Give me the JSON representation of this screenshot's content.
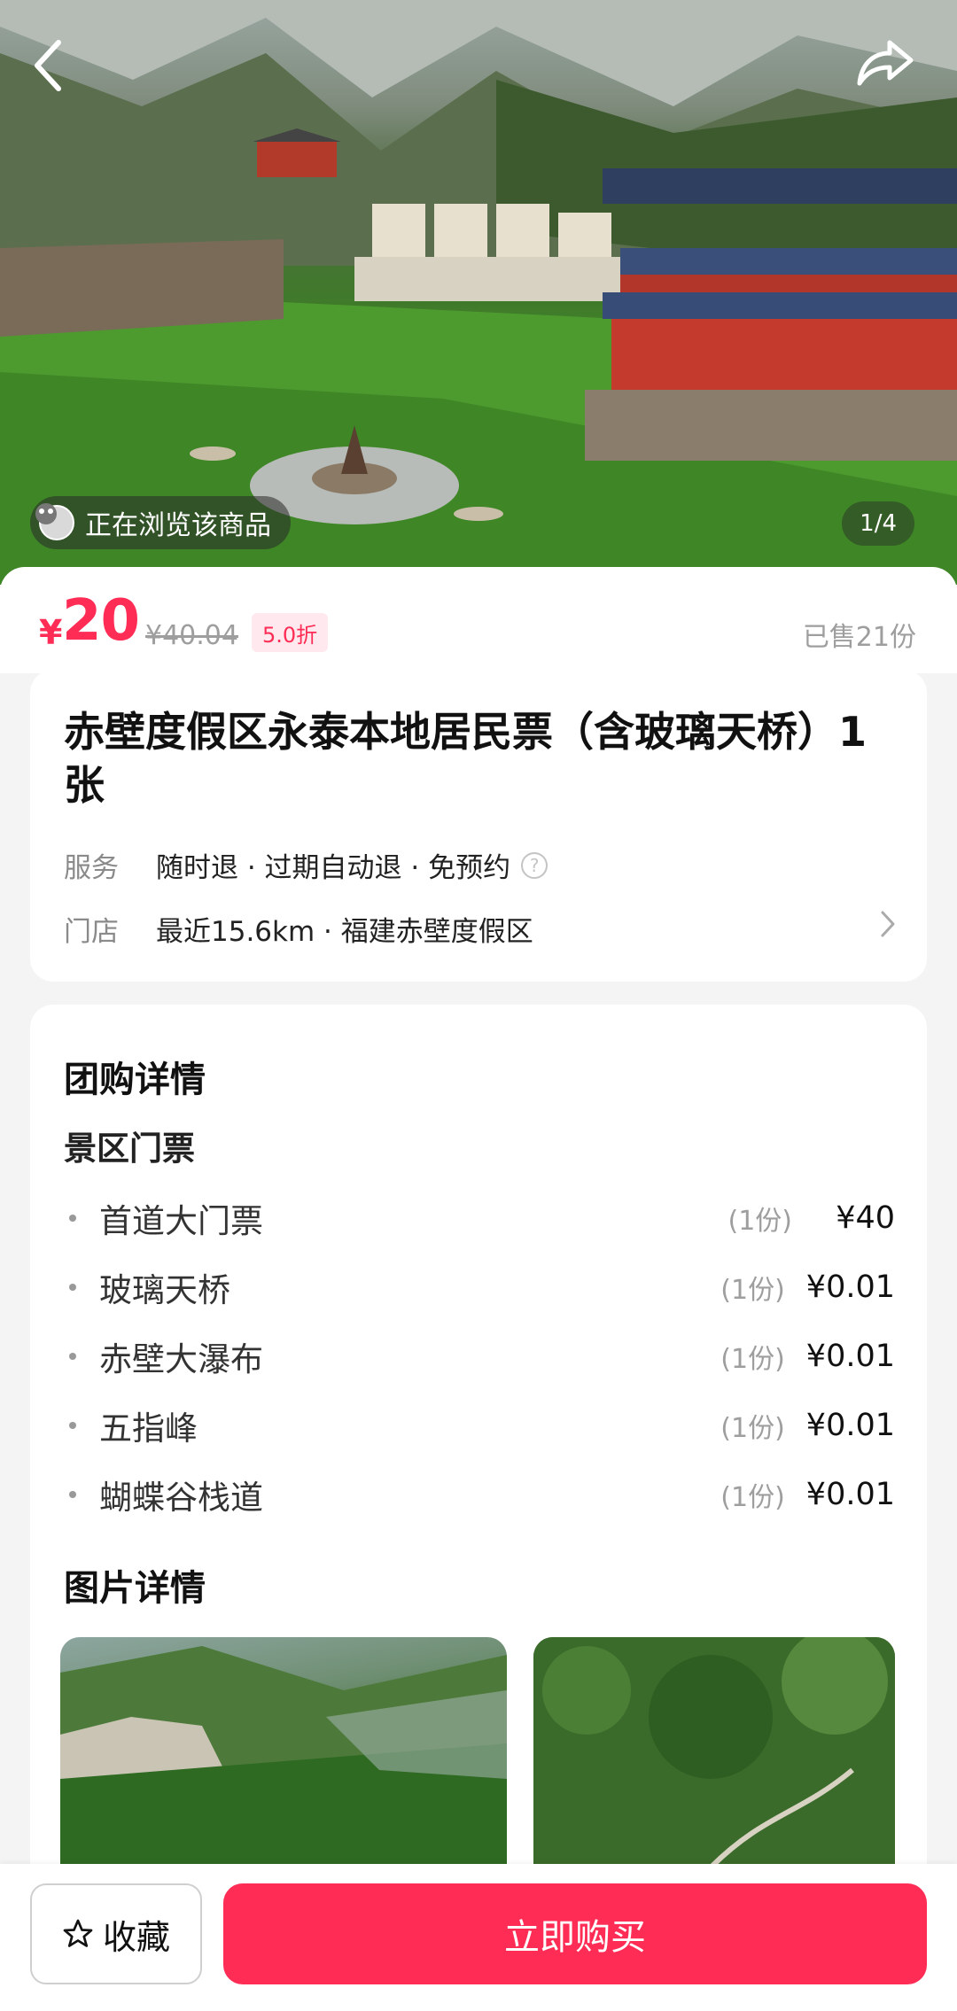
{
  "hero": {
    "browsing_text": "正在浏览该商品",
    "image_counter": "1/4",
    "icons": [
      "back-arrow-icon",
      "share-icon",
      "avatar"
    ]
  },
  "price": {
    "currency": "¥",
    "current": "20",
    "original": "¥40.04",
    "discount": "5.0折",
    "sold": "已售21份"
  },
  "product": {
    "title": "赤壁度假区永泰本地居民票（含玻璃天桥）1张",
    "service_label": "服务",
    "service_value": "随时退 · 过期自动退 · 免预约",
    "store_label": "门店",
    "store_value": "最近15.6km · 福建赤壁度假区"
  },
  "group_details": {
    "heading": "团购详情",
    "subheading": "景区门票",
    "items": [
      {
        "name": "首道大门票",
        "qty": "(1份)",
        "price": "¥40"
      },
      {
        "name": "玻璃天桥",
        "qty": "(1份)",
        "price": "¥0.01"
      },
      {
        "name": "赤壁大瀑布",
        "qty": "(1份)",
        "price": "¥0.01"
      },
      {
        "name": "五指峰",
        "qty": "(1份)",
        "price": "¥0.01"
      },
      {
        "name": "蝴蝶谷栈道",
        "qty": "(1份)",
        "price": "¥0.01"
      }
    ]
  },
  "photo_details": {
    "heading": "图片详情"
  },
  "bottom_bar": {
    "favorite_label": "收藏",
    "buy_label": "立即购买"
  },
  "colors": {
    "accent": "#ff2c55",
    "discount_bg": "#ffe9ee",
    "muted": "#9e9e9e"
  }
}
